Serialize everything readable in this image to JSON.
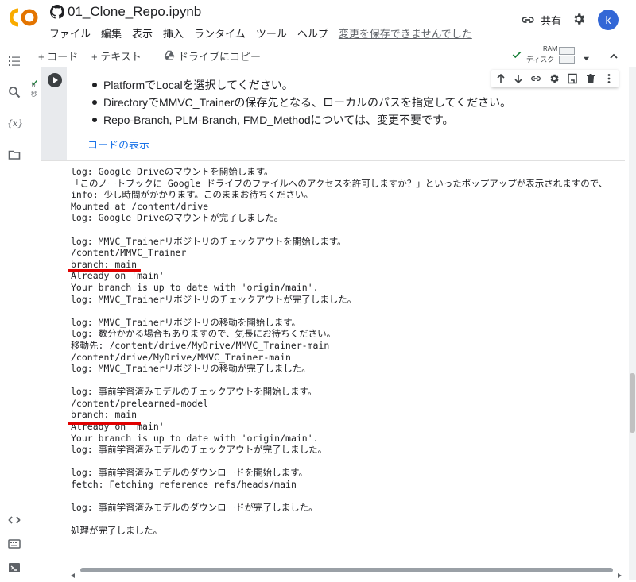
{
  "header": {
    "logo_text": "CO",
    "title": "01_Clone_Repo.ipynb",
    "menu": [
      "ファイル",
      "編集",
      "表示",
      "挿入",
      "ランタイム",
      "ツール",
      "ヘルプ"
    ],
    "unsaved_notice": "変更を保存できませんでした",
    "share_label": "共有",
    "avatar_letter": "k"
  },
  "toolbar": {
    "add_code": "+ コード",
    "add_text": "+ テキスト",
    "copy_to_drive": "ドライブにコピー",
    "ram_label": "RAM",
    "disk_label": "ディスク"
  },
  "cell": {
    "exec_time": "0",
    "exec_unit": "秒",
    "bullets": [
      "PlatformでLocalを選択してください。",
      "DirectoryでMMVC_Trainerの保存先となる、ローカルのパスを指定してください。",
      "Repo-Branch, PLM-Branch, FMD_Methodについては、変更不要です。"
    ],
    "show_code": "コードの表示"
  },
  "output": {
    "lines": [
      "log: Google Driveのマウントを開始します。",
      "「このノートブックに Google ドライブのファイルへのアクセスを許可しますか？」といったポップアップが表示されますので、",
      "info: 少し時間がかかります。このままお待ちください。",
      "Mounted at /content/drive",
      "log: Google Driveのマウントが完了しました。",
      "",
      "log: MMVC_Trainerリポジトリのチェックアウトを開始します。",
      "/content/MMVC_Trainer",
      "branch: main",
      "Already on 'main'",
      "Your branch is up to date with 'origin/main'.",
      "log: MMVC_Trainerリポジトリのチェックアウトが完了しました。",
      "",
      "log: MMVC_Trainerリポジトリの移動を開始します。",
      "log: 数分かかる場合もありますので、気長にお待ちください。",
      "移動先: /content/drive/MyDrive/MMVC_Trainer-main",
      "/content/drive/MyDrive/MMVC_Trainer-main",
      "log: MMVC_Trainerリポジトリの移動が完了しました。",
      "",
      "log: 事前学習済みモデルのチェックアウトを開始します。",
      "/content/prelearned-model",
      "branch: main",
      "Already on 'main'",
      "Your branch is up to date with 'origin/main'.",
      "log: 事前学習済みモデルのチェックアウトが完了しました。",
      "",
      "log: 事前学習済みモデルのダウンロードを開始します。",
      "fetch: Fetching reference refs/heads/main",
      "",
      "log: 事前学習済みモデルのダウンロードが完了しました。",
      "",
      "処理が完了しました。"
    ]
  },
  "colors": {
    "accent": "#1a73e8",
    "highlight_red": "#e00000",
    "logo_orange": "#f9ab00",
    "avatar_blue": "#3367d6",
    "ok_green": "#188038"
  }
}
